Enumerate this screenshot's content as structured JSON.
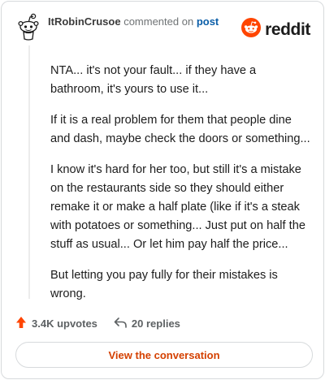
{
  "header": {
    "author": "ItRobinCrusoe",
    "action": "commented on",
    "post_link": "post",
    "logo_text": "reddit",
    "avatar_icon": "snoo-avatar-icon",
    "logo_icon": "reddit-logo-icon"
  },
  "comment": {
    "paragraphs": [
      "NTA... it's not your fault... if they have a bathroom, it's yours to use it...",
      "If it is a real problem for them that people dine and dash, maybe check the doors or something...",
      "I know it's hard for her too, but still it's a mistake on the restaurants side so they should either remake it or make a half plate (like if it's a steak with potatoes or something... Just put on half the stuff as usual... Or let him pay half the price...",
      "But letting you pay fully for their mistakes is wrong."
    ]
  },
  "footer": {
    "upvotes": "3.4K upvotes",
    "replies": "20 replies",
    "upvote_icon": "upvote-arrow-icon",
    "reply_icon": "reply-arrow-icon"
  },
  "cta": {
    "label": "View the conversation"
  },
  "colors": {
    "accent": "#d44000",
    "upvote": "#ff4500",
    "link": "#0b5ea8",
    "border": "#d7dadc"
  }
}
